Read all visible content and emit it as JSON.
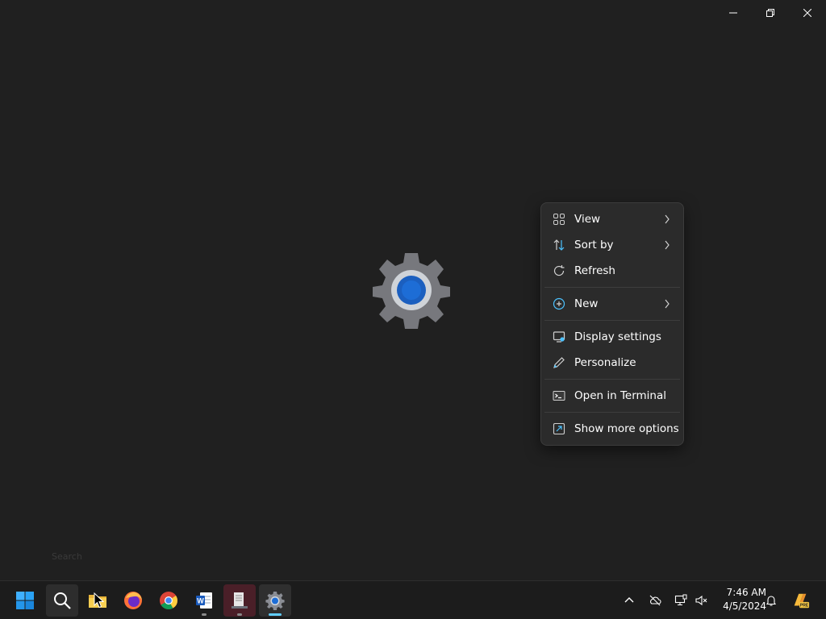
{
  "menu": {
    "items": [
      {
        "label": "View",
        "icon": "grid-view-icon",
        "submenu": true
      },
      {
        "label": "Sort by",
        "icon": "sort-icon",
        "submenu": true
      },
      {
        "label": "Refresh",
        "icon": "refresh-icon",
        "submenu": false
      },
      {
        "label": "New",
        "icon": "plus-circle-icon",
        "submenu": true
      },
      {
        "label": "Display settings",
        "icon": "display-settings-icon",
        "submenu": false
      },
      {
        "label": "Personalize",
        "icon": "pen-icon",
        "submenu": false
      },
      {
        "label": "Open in Terminal",
        "icon": "terminal-icon",
        "submenu": false
      },
      {
        "label": "Show more options",
        "icon": "more-options-icon",
        "submenu": false
      }
    ]
  },
  "desktop": {
    "search_placeholder": "Search"
  },
  "taskbar": {
    "apps": [
      "start",
      "search",
      "file-explorer",
      "firefox",
      "chrome",
      "word",
      "terminal-app",
      "settings"
    ],
    "clock_time": "7:46 AM",
    "clock_date": "4/5/2024",
    "accent": "#60cdff"
  }
}
